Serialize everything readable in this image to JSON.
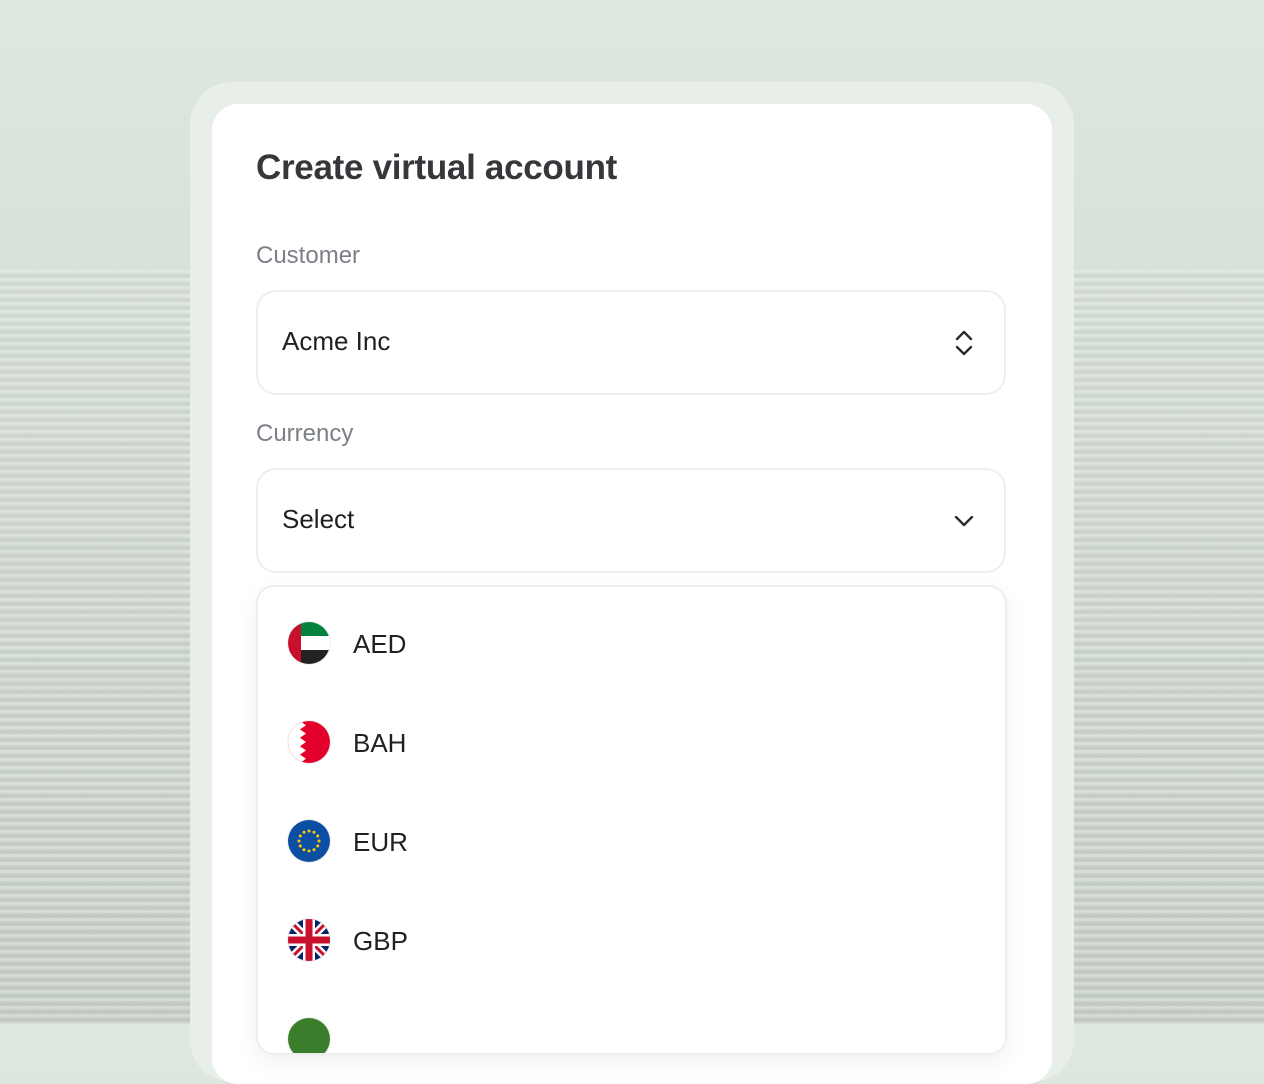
{
  "form": {
    "title": "Create virtual account",
    "customer_label": "Customer",
    "customer_value": "Acme Inc",
    "currency_label": "Currency",
    "currency_placeholder": "Select"
  },
  "currency_options": [
    {
      "code": "AED",
      "flag": "uae-flag-icon"
    },
    {
      "code": "BAH",
      "flag": "bahrain-flag-icon"
    },
    {
      "code": "EUR",
      "flag": "eu-flag-icon"
    },
    {
      "code": "GBP",
      "flag": "uk-flag-icon"
    },
    {
      "code": "",
      "flag": "green-flag-icon"
    }
  ],
  "colors": {
    "background": "#d3dcd4",
    "card": "#ffffff",
    "title_text": "#35373b",
    "label_text": "#7b7f86",
    "border": "#eceef0"
  }
}
